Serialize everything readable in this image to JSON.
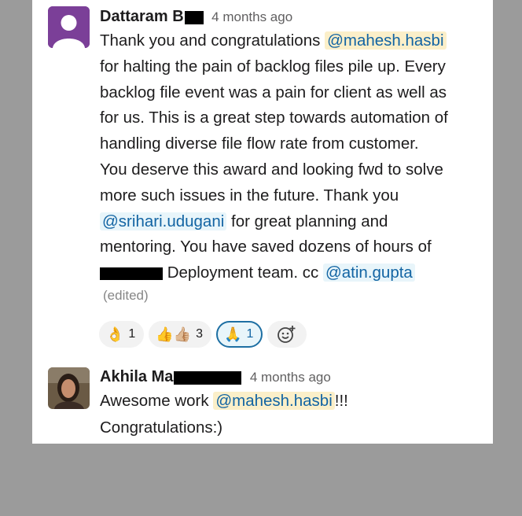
{
  "messages": [
    {
      "author_prefix": "Dattaram B",
      "time": "4 months ago",
      "lines": [
        {
          "parts": [
            {
              "t": "Thank you and congratulations "
            },
            {
              "m": "@mahesh.hasbi",
              "style": "yellow"
            }
          ]
        },
        {
          "parts": [
            {
              "t": "for halting the pain of backlog files pile up. Every"
            }
          ]
        },
        {
          "parts": [
            {
              "t": "backlog file event was a pain for client as well as"
            }
          ]
        },
        {
          "parts": [
            {
              "t": "for us. This is a great step towards automation of"
            }
          ]
        },
        {
          "parts": [
            {
              "t": "handling diverse file flow rate from customer."
            }
          ]
        },
        {
          "parts": [
            {
              "t": "You deserve this award and looking fwd to solve"
            }
          ]
        },
        {
          "parts": [
            {
              "t": "more such issues in the future. Thank you"
            }
          ]
        },
        {
          "parts": [
            {
              "m": "@srihari.udugani",
              "style": "blue"
            },
            {
              "t": " for great planning and"
            }
          ]
        },
        {
          "parts": [
            {
              "t": "mentoring. You have saved dozens of hours of"
            }
          ]
        },
        {
          "parts": [
            {
              "redact": true
            },
            {
              "t": " Deployment team. cc "
            },
            {
              "m": "@atin.gupta",
              "style": "blue"
            }
          ]
        }
      ],
      "edited": "(edited)",
      "reactions": [
        {
          "icon": "ok-hand-icon",
          "emoji": "👌",
          "count": "1",
          "active": false
        },
        {
          "icon": "thumbs-up-icon",
          "emoji": "👍👍🏼",
          "count": "3",
          "active": false
        },
        {
          "icon": "pray-icon",
          "emoji": "🙏",
          "count": "1",
          "active": true
        }
      ],
      "add_reaction_icon": "add-reaction-icon"
    },
    {
      "author_prefix": "Akhila Ma",
      "time": "4 months ago",
      "lines": [
        {
          "parts": [
            {
              "t": "Awesome work "
            },
            {
              "m": "@mahesh.hasbi",
              "style": "yellow"
            },
            {
              "t": "!!!"
            }
          ]
        },
        {
          "parts": [
            {
              "t": "Congratulations:)"
            }
          ]
        }
      ]
    }
  ],
  "colors": {
    "mention_yellow_bg": "#fbefc9",
    "mention_blue_bg": "#e8f5fa",
    "mention_text": "#1264a3",
    "avatar1": "#7b3f98"
  }
}
